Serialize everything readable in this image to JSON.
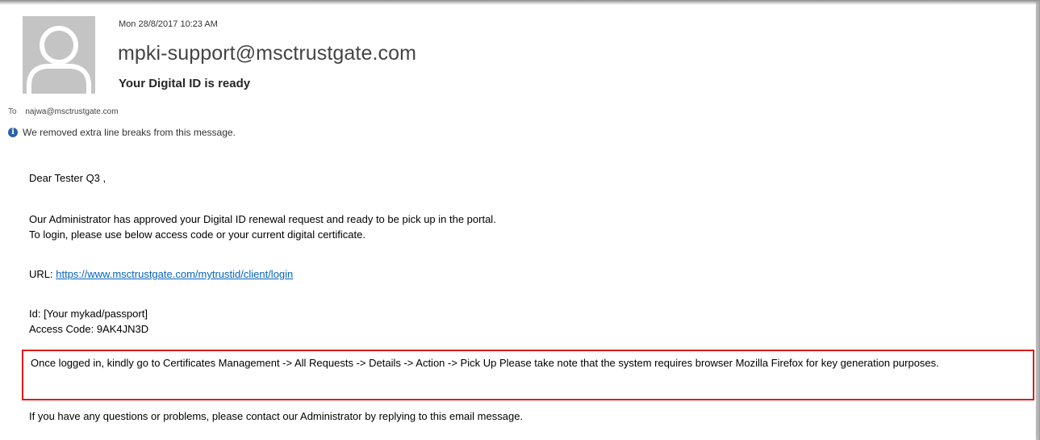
{
  "email": {
    "timestamp": "Mon 28/8/2017 10:23 AM",
    "sender": "mpki-support@msctrustgate.com",
    "subject": "Your Digital ID is ready",
    "to_label": "To",
    "to_address": "najwa@msctrustgate.com",
    "info_message": "We removed extra line breaks from this message.",
    "info_icon": "info-icon"
  },
  "body": {
    "greeting": "Dear Tester Q3 ,",
    "approved_line1": "Our Administrator has approved your Digital ID renewal request and ready to be pick up in the portal.",
    "approved_line2": "To login, please use below access code or your current digital certificate.",
    "url_label": "URL: ",
    "url": "https://www.msctrustgate.com/mytrustid/client/login",
    "id_line": "Id: [Your mykad/passport]",
    "access_code_line": "Access Code: 9AK4JN3D",
    "note": "Once logged in, kindly go to Certificates Management -> All Requests -> Details -> Action -> Pick Up Please take note that the system requires browser Mozilla Firefox for key generation purposes.",
    "contact": "If you have any questions or problems, please contact our Administrator by replying to this email message."
  },
  "colors": {
    "highlight_border": "#e01a1a",
    "link": "#0563c1",
    "info_icon": "#2b62a8",
    "avatar_bg": "#c4c4c4"
  }
}
